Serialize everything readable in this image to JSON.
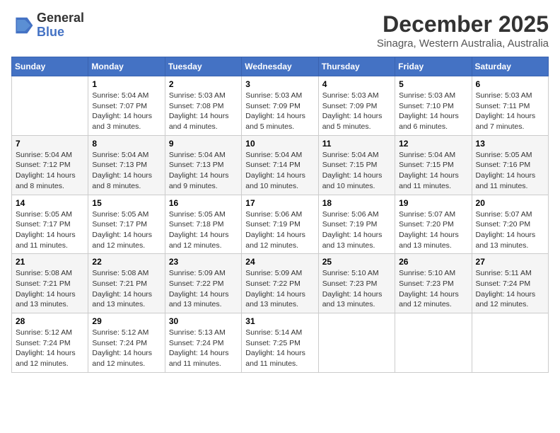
{
  "logo": {
    "text1": "General",
    "text2": "Blue"
  },
  "title": "December 2025",
  "subtitle": "Sinagra, Western Australia, Australia",
  "weekdays": [
    "Sunday",
    "Monday",
    "Tuesday",
    "Wednesday",
    "Thursday",
    "Friday",
    "Saturday"
  ],
  "weeks": [
    [
      {
        "day": "",
        "info": ""
      },
      {
        "day": "1",
        "info": "Sunrise: 5:04 AM\nSunset: 7:07 PM\nDaylight: 14 hours\nand 3 minutes."
      },
      {
        "day": "2",
        "info": "Sunrise: 5:03 AM\nSunset: 7:08 PM\nDaylight: 14 hours\nand 4 minutes."
      },
      {
        "day": "3",
        "info": "Sunrise: 5:03 AM\nSunset: 7:09 PM\nDaylight: 14 hours\nand 5 minutes."
      },
      {
        "day": "4",
        "info": "Sunrise: 5:03 AM\nSunset: 7:09 PM\nDaylight: 14 hours\nand 5 minutes."
      },
      {
        "day": "5",
        "info": "Sunrise: 5:03 AM\nSunset: 7:10 PM\nDaylight: 14 hours\nand 6 minutes."
      },
      {
        "day": "6",
        "info": "Sunrise: 5:03 AM\nSunset: 7:11 PM\nDaylight: 14 hours\nand 7 minutes."
      }
    ],
    [
      {
        "day": "7",
        "info": "Sunrise: 5:04 AM\nSunset: 7:12 PM\nDaylight: 14 hours\nand 8 minutes."
      },
      {
        "day": "8",
        "info": "Sunrise: 5:04 AM\nSunset: 7:13 PM\nDaylight: 14 hours\nand 8 minutes."
      },
      {
        "day": "9",
        "info": "Sunrise: 5:04 AM\nSunset: 7:13 PM\nDaylight: 14 hours\nand 9 minutes."
      },
      {
        "day": "10",
        "info": "Sunrise: 5:04 AM\nSunset: 7:14 PM\nDaylight: 14 hours\nand 10 minutes."
      },
      {
        "day": "11",
        "info": "Sunrise: 5:04 AM\nSunset: 7:15 PM\nDaylight: 14 hours\nand 10 minutes."
      },
      {
        "day": "12",
        "info": "Sunrise: 5:04 AM\nSunset: 7:15 PM\nDaylight: 14 hours\nand 11 minutes."
      },
      {
        "day": "13",
        "info": "Sunrise: 5:05 AM\nSunset: 7:16 PM\nDaylight: 14 hours\nand 11 minutes."
      }
    ],
    [
      {
        "day": "14",
        "info": "Sunrise: 5:05 AM\nSunset: 7:17 PM\nDaylight: 14 hours\nand 11 minutes."
      },
      {
        "day": "15",
        "info": "Sunrise: 5:05 AM\nSunset: 7:17 PM\nDaylight: 14 hours\nand 12 minutes."
      },
      {
        "day": "16",
        "info": "Sunrise: 5:05 AM\nSunset: 7:18 PM\nDaylight: 14 hours\nand 12 minutes."
      },
      {
        "day": "17",
        "info": "Sunrise: 5:06 AM\nSunset: 7:19 PM\nDaylight: 14 hours\nand 12 minutes."
      },
      {
        "day": "18",
        "info": "Sunrise: 5:06 AM\nSunset: 7:19 PM\nDaylight: 14 hours\nand 13 minutes."
      },
      {
        "day": "19",
        "info": "Sunrise: 5:07 AM\nSunset: 7:20 PM\nDaylight: 14 hours\nand 13 minutes."
      },
      {
        "day": "20",
        "info": "Sunrise: 5:07 AM\nSunset: 7:20 PM\nDaylight: 14 hours\nand 13 minutes."
      }
    ],
    [
      {
        "day": "21",
        "info": "Sunrise: 5:08 AM\nSunset: 7:21 PM\nDaylight: 14 hours\nand 13 minutes."
      },
      {
        "day": "22",
        "info": "Sunrise: 5:08 AM\nSunset: 7:21 PM\nDaylight: 14 hours\nand 13 minutes."
      },
      {
        "day": "23",
        "info": "Sunrise: 5:09 AM\nSunset: 7:22 PM\nDaylight: 14 hours\nand 13 minutes."
      },
      {
        "day": "24",
        "info": "Sunrise: 5:09 AM\nSunset: 7:22 PM\nDaylight: 14 hours\nand 13 minutes."
      },
      {
        "day": "25",
        "info": "Sunrise: 5:10 AM\nSunset: 7:23 PM\nDaylight: 14 hours\nand 13 minutes."
      },
      {
        "day": "26",
        "info": "Sunrise: 5:10 AM\nSunset: 7:23 PM\nDaylight: 14 hours\nand 12 minutes."
      },
      {
        "day": "27",
        "info": "Sunrise: 5:11 AM\nSunset: 7:24 PM\nDaylight: 14 hours\nand 12 minutes."
      }
    ],
    [
      {
        "day": "28",
        "info": "Sunrise: 5:12 AM\nSunset: 7:24 PM\nDaylight: 14 hours\nand 12 minutes."
      },
      {
        "day": "29",
        "info": "Sunrise: 5:12 AM\nSunset: 7:24 PM\nDaylight: 14 hours\nand 12 minutes."
      },
      {
        "day": "30",
        "info": "Sunrise: 5:13 AM\nSunset: 7:24 PM\nDaylight: 14 hours\nand 11 minutes."
      },
      {
        "day": "31",
        "info": "Sunrise: 5:14 AM\nSunset: 7:25 PM\nDaylight: 14 hours\nand 11 minutes."
      },
      {
        "day": "",
        "info": ""
      },
      {
        "day": "",
        "info": ""
      },
      {
        "day": "",
        "info": ""
      }
    ]
  ]
}
